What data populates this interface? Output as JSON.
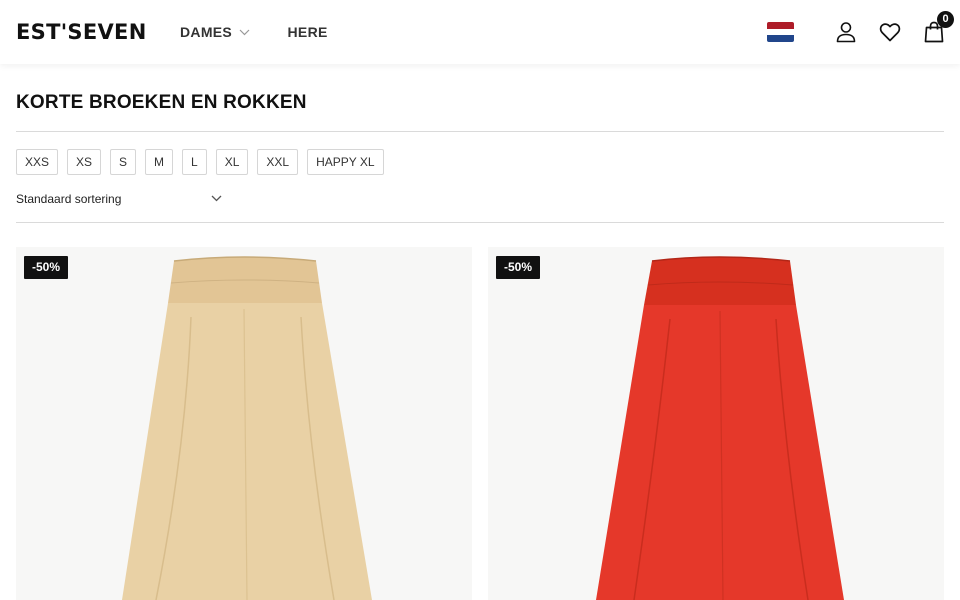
{
  "header": {
    "logo": "EST'SEVEN",
    "nav": [
      {
        "label": "DAMES",
        "has_dropdown": true
      },
      {
        "label": "HEREN",
        "has_dropdown": false
      }
    ],
    "icons": [
      "netherlands-flag-icon",
      "user-icon",
      "heart-icon",
      "shopping-bag-icon"
    ],
    "cart_count": "0"
  },
  "page": {
    "title": "KORTE BROEKEN EN ROKKEN",
    "sizes": [
      "XXS",
      "XS",
      "S",
      "M",
      "L",
      "XL",
      "XXL",
      "HAPPY XL"
    ],
    "sort_label": "Standaard sortering"
  },
  "products": [
    {
      "badge": "-50%",
      "color": "#e9d1a5"
    },
    {
      "badge": "-50%",
      "color": "#e5382a"
    }
  ],
  "colors": {
    "flag_red": "#ae1c28",
    "flag_white": "#ffffff",
    "flag_blue": "#21468b",
    "text": "#111111",
    "divider": "#dadada"
  }
}
